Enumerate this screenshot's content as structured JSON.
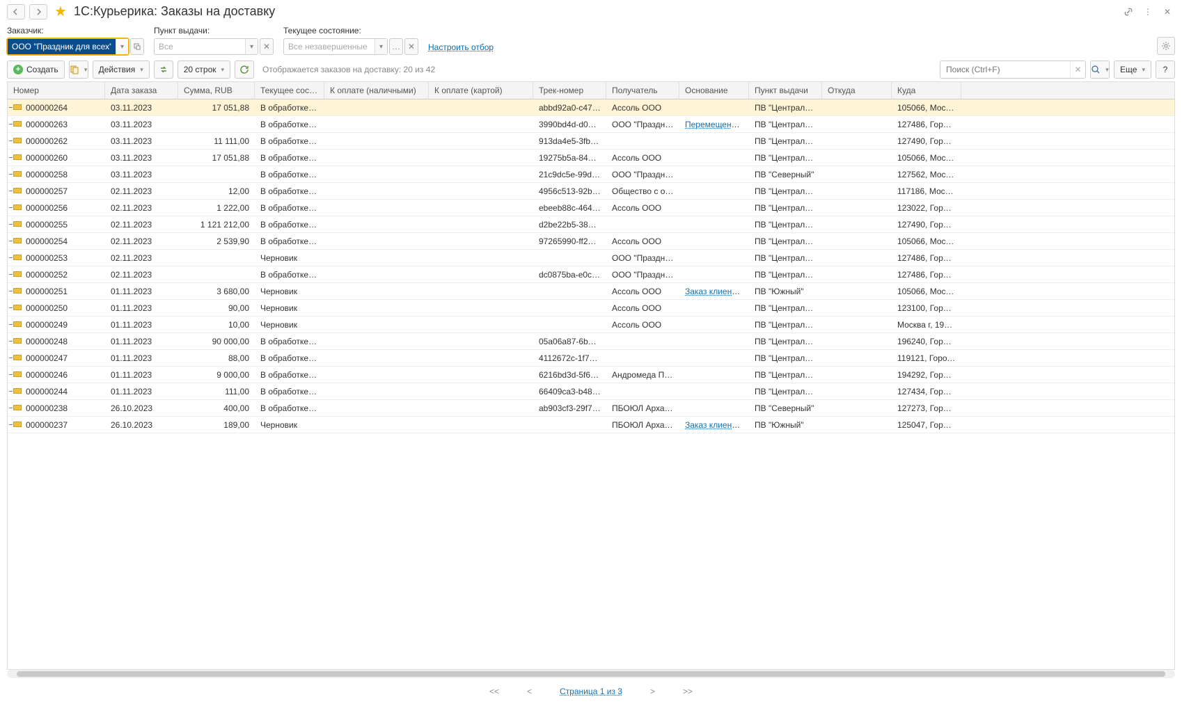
{
  "header": {
    "title": "1С:Курьерика: Заказы на доставку"
  },
  "filters": {
    "customer": {
      "label": "Заказчик:",
      "value": "ООО \"Праздник для всех\""
    },
    "pickup": {
      "label": "Пункт выдачи:",
      "placeholder": "Все"
    },
    "state": {
      "label": "Текущее состояние:",
      "placeholder": "Все незавершенные"
    },
    "configure_link": "Настроить отбор"
  },
  "toolbar": {
    "create": "Создать",
    "actions": "Действия",
    "rows": "20 строк",
    "info": "Отображается заказов на доставку: 20 из 42",
    "search_placeholder": "Поиск (Ctrl+F)",
    "more": "Еще"
  },
  "columns": [
    "Номер",
    "Дата заказа",
    "Сумма, RUB",
    "Текущее состоя...",
    "К оплате (наличными)",
    "К оплате (картой)",
    "Трек-номер",
    "Получатель",
    "Основание",
    "Пункт выдачи",
    "Откуда",
    "Куда"
  ],
  "rows": [
    {
      "sel": true,
      "num": "000000264",
      "date": "03.11.2023",
      "sum": "17 051,88",
      "state": "В обработке (но...",
      "cash": "",
      "card": "",
      "track": "abbd92a0-c47d-...",
      "recv": "Ассоль ООО",
      "base": "",
      "pv": "ПВ \"Центральн...",
      "from": "",
      "to": "105066, Москва..."
    },
    {
      "num": "000000263",
      "date": "03.11.2023",
      "sum": "",
      "state": "В обработке (но...",
      "cash": "",
      "card": "",
      "track": "3990bd4d-d061-...",
      "recv": "ООО \"Праздник...",
      "base": "Перемещение т...",
      "base_link": true,
      "pv": "ПВ \"Центральн...",
      "from": "",
      "to": "127486, Город ..."
    },
    {
      "num": "000000262",
      "date": "03.11.2023",
      "sum": "11 111,00",
      "state": "В обработке (но...",
      "cash": "",
      "card": "",
      "track": "913da4e5-3fb2-4...",
      "recv": "",
      "base": "",
      "pv": "ПВ \"Центральн...",
      "from": "",
      "to": "127490, Город ..."
    },
    {
      "num": "000000260",
      "date": "03.11.2023",
      "sum": "17 051,88",
      "state": "В обработке (но...",
      "cash": "",
      "card": "",
      "track": "19275b5a-8492-...",
      "recv": "Ассоль ООО",
      "base": "",
      "pv": "ПВ \"Центральн...",
      "from": "",
      "to": "105066, Москва..."
    },
    {
      "num": "000000258",
      "date": "03.11.2023",
      "sum": "",
      "state": "В обработке (но...",
      "cash": "",
      "card": "",
      "track": "21c9dc5e-99dc-...",
      "recv": "ООО \"Праздник...",
      "base": "",
      "pv": "ПВ \"Северный\"",
      "from": "",
      "to": "127562, Москва..."
    },
    {
      "num": "000000257",
      "date": "02.11.2023",
      "sum": "12,00",
      "state": "В обработке (но...",
      "cash": "",
      "card": "",
      "track": "4956c513-92bc-...",
      "recv": "Общество с огр...",
      "base": "",
      "pv": "ПВ \"Центральн...",
      "from": "",
      "to": "117186, Москва..."
    },
    {
      "num": "000000256",
      "date": "02.11.2023",
      "sum": "1 222,00",
      "state": "В обработке (но...",
      "cash": "",
      "card": "",
      "track": "ebeeb88c-4640-...",
      "recv": "Ассоль ООО",
      "base": "",
      "pv": "ПВ \"Центральн...",
      "from": "",
      "to": "123022, Город ..."
    },
    {
      "num": "000000255",
      "date": "02.11.2023",
      "sum": "1 121 212,00",
      "state": "В обработке (но...",
      "cash": "",
      "card": "",
      "track": "d2be22b5-3879-...",
      "recv": "",
      "base": "",
      "pv": "ПВ \"Центральн...",
      "from": "",
      "to": "127490, Город ..."
    },
    {
      "num": "000000254",
      "date": "02.11.2023",
      "sum": "2 539,90",
      "state": "В обработке (но...",
      "cash": "",
      "card": "",
      "track": "97265990-ff26-4...",
      "recv": "Ассоль ООО",
      "base": "",
      "pv": "ПВ \"Центральн...",
      "from": "",
      "to": "105066, Москва..."
    },
    {
      "num": "000000253",
      "date": "02.11.2023",
      "sum": "",
      "state": "Черновик",
      "cash": "",
      "card": "",
      "track": "",
      "recv": "ООО \"Праздник...",
      "base": "",
      "pv": "ПВ \"Центральн...",
      "from": "",
      "to": "127486, Город ..."
    },
    {
      "num": "000000252",
      "date": "02.11.2023",
      "sum": "",
      "state": "В обработке (но...",
      "cash": "",
      "card": "",
      "track": "dc0875ba-e0c4-...",
      "recv": "ООО \"Праздник...",
      "base": "",
      "pv": "ПВ \"Центральн...",
      "from": "",
      "to": "127486, Город ..."
    },
    {
      "num": "000000251",
      "date": "01.11.2023",
      "sum": "3 680,00",
      "state": "Черновик",
      "cash": "",
      "card": "",
      "track": "",
      "recv": "Ассоль ООО",
      "base": "Заказ клиента 0...",
      "base_link": true,
      "pv": "ПВ \"Южный\"",
      "from": "",
      "to": "105066, Москва..."
    },
    {
      "num": "000000250",
      "date": "01.11.2023",
      "sum": "90,00",
      "state": "Черновик",
      "cash": "",
      "card": "",
      "track": "",
      "recv": "Ассоль ООО",
      "base": "",
      "pv": "ПВ \"Центральн...",
      "from": "",
      "to": "123100, Город ..."
    },
    {
      "num": "000000249",
      "date": "01.11.2023",
      "sum": "10,00",
      "state": "Черновик",
      "cash": "",
      "card": "",
      "track": "",
      "recv": "Ассоль ООО",
      "base": "",
      "pv": "ПВ \"Центральн...",
      "from": "",
      "to": "Москва г, 1905 ..."
    },
    {
      "num": "000000248",
      "date": "01.11.2023",
      "sum": "90 000,00",
      "state": "В обработке (но...",
      "cash": "",
      "card": "",
      "track": "05a06a87-6b6f-4...",
      "recv": "",
      "base": "",
      "pv": "ПВ \"Центральн...",
      "from": "",
      "to": "196240, Город ..."
    },
    {
      "num": "000000247",
      "date": "01.11.2023",
      "sum": "88,00",
      "state": "В обработке (но...",
      "cash": "",
      "card": "",
      "track": "4112672c-1f78-4...",
      "recv": "",
      "base": "",
      "pv": "ПВ \"Центральн...",
      "from": "",
      "to": "119121, Город ..."
    },
    {
      "num": "000000246",
      "date": "01.11.2023",
      "sum": "9 000,00",
      "state": "В обработке (но...",
      "cash": "",
      "card": "",
      "track": "6216bd3d-5f63-4...",
      "recv": "Андромеда Плюс",
      "base": "",
      "pv": "ПВ \"Центральн...",
      "from": "",
      "to": "194292, Город ..."
    },
    {
      "num": "000000244",
      "date": "01.11.2023",
      "sum": "111,00",
      "state": "В обработке (но...",
      "cash": "",
      "card": "",
      "track": "66409ca3-b48f-4...",
      "recv": "",
      "base": "",
      "pv": "ПВ \"Центральн...",
      "from": "",
      "to": "127434, Город ..."
    },
    {
      "num": "000000238",
      "date": "26.10.2023",
      "sum": "400,00",
      "state": "В обработке (но...",
      "cash": "",
      "card": "",
      "track": "ab903cf3-29f7-4...",
      "recv": "ПБОЮЛ Архаров",
      "base": "",
      "pv": "ПВ \"Северный\"",
      "from": "",
      "to": "127273, Город ..."
    },
    {
      "num": "000000237",
      "date": "26.10.2023",
      "sum": "189,00",
      "state": "Черновик",
      "cash": "",
      "card": "",
      "track": "",
      "recv": "ПБОЮЛ Архаров",
      "base": "Заказ клиента 0...",
      "base_link": true,
      "pv": "ПВ \"Южный\"",
      "from": "",
      "to": "125047, Город ..."
    }
  ],
  "pager": {
    "first": "<<",
    "prev": "<",
    "current": "Страница 1 из 3",
    "next": ">",
    "last": ">>"
  }
}
